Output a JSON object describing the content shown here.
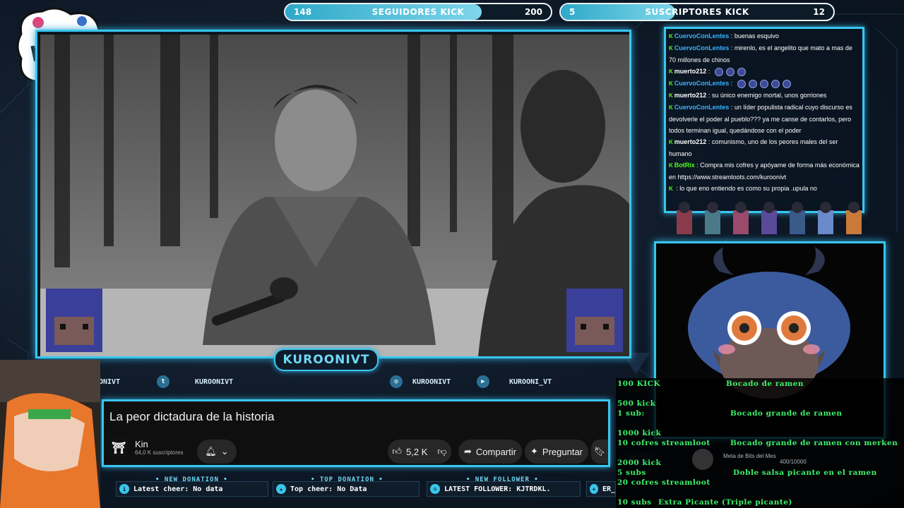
{
  "counters": {
    "followers": {
      "current": "148",
      "label": "SEGUIDORES KICK",
      "goal": "200",
      "progress": 0.74
    },
    "subscribers": {
      "current": "5",
      "label": "SUSCRIPTORES KICK",
      "goal": "12",
      "progress": 0.42
    }
  },
  "streamer_name": "KUROONIVT",
  "social": {
    "handle1": "ONIVT",
    "twitter": "KUROONIVT",
    "instagram": "KUROONIVT",
    "youtube": "KUROONI_VT"
  },
  "chat": {
    "messages": [
      {
        "user": "CuervoConLentes",
        "color": "#3ab4ff",
        "badges": "K",
        "text": "buenas esquivo"
      },
      {
        "user": "CuervoConLentes",
        "color": "#3ab4ff",
        "badges": "K",
        "text": "mirenlo, es el angelito que mato a mas de 70 millones de chinos"
      },
      {
        "user": "muerto212",
        "color": "#ffffff",
        "badges": "K",
        "text": "",
        "emotes": 3
      },
      {
        "user": "CuervoConLentes",
        "color": "#3ab4ff",
        "badges": "K",
        "text": "",
        "emotes": 5
      },
      {
        "user": "muerto212",
        "color": "#ffffff",
        "badges": "K",
        "text": "su único enemigo mortal, unos gorriones"
      },
      {
        "user": "CuervoConLentes",
        "color": "#3ab4ff",
        "badges": "K",
        "text": "un líder populista radical cuyo discurso es devolverle el poder al pueblo??? ya me canse de contarlos, pero todos terminan igual, quedándose con el poder"
      },
      {
        "user": "muerto212",
        "color": "#ffffff",
        "badges": "K",
        "text": "comunismo, uno de los peores males del ser humano"
      },
      {
        "user": "BotRix",
        "color": "#53fc18",
        "badges": "K",
        "text": "Compra mis cofres y apóyame de forma más económica en https://www.streamloots.com/kuroonivt"
      },
      {
        "user": "",
        "color": "#ff3b3b",
        "badges": "K",
        "text": "lo que eno entiendo es como su propia .upula no"
      }
    ]
  },
  "youtube": {
    "title": "La peor dictadura de la historia",
    "channel": "Kin",
    "subscribers": "64,0 K suscriptores",
    "likes": "5,2 K",
    "share": "Compartir",
    "ask": "Preguntar"
  },
  "ticker": {
    "new_donation": {
      "head": "NEW DONATION",
      "text": "Latest cheer: No data"
    },
    "top_donation": {
      "head": "TOP DONATION",
      "text": "Top cheer: No Data"
    },
    "new_follower": {
      "head": "NEW FOLLOWER",
      "text": "LATEST FOLLOWER: KJTRDKL."
    },
    "extra": {
      "text": "ER_"
    }
  },
  "bits_goal": {
    "label": "Meta de Bits del Mes",
    "value": "400/10000"
  },
  "rewards": [
    {
      "cost": "100 KICK",
      "reward": "Bocado de ramen"
    },
    {
      "cost": "500 kick",
      "reward": ""
    },
    {
      "cost": "1 sub:",
      "reward": "Bocado grande de ramen"
    },
    {
      "cost": "1000 kick",
      "reward": ""
    },
    {
      "cost": "10 cofres streamloot",
      "reward": "Bocado grande de ramen con merken"
    },
    {
      "cost": "2000 kick",
      "reward": ""
    },
    {
      "cost": "5 subs",
      "reward": "Doble salsa picante en el ramen"
    },
    {
      "cost": "20 cofres streamloot",
      "reward": ""
    },
    {
      "cost": "10 subs",
      "reward": "Extra Picante (Triple picante)"
    }
  ],
  "colors": {
    "accent": "#39c6ee",
    "kick_green": "#53fc18",
    "reward_green": "#3df06a"
  }
}
